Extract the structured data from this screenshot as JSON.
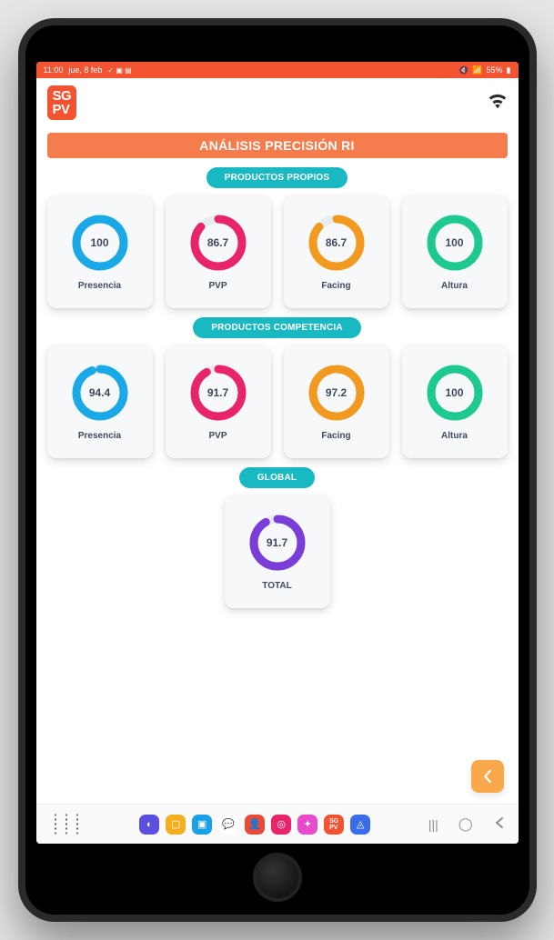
{
  "status": {
    "time": "11:00",
    "date": "jue, 8 feb",
    "battery": "55%"
  },
  "app": {
    "logo_line1": "SG",
    "logo_line2": "PV"
  },
  "title": "ANÁLISIS PRECISIÓN RI",
  "sections": [
    {
      "label": "PRODUCTOS PROPIOS",
      "cards": [
        {
          "value": "100",
          "pct": 100,
          "label": "Presencia",
          "color": "#18a9e6"
        },
        {
          "value": "86.7",
          "pct": 86.7,
          "label": "PVP",
          "color": "#e8256b"
        },
        {
          "value": "86.7",
          "pct": 86.7,
          "label": "Facing",
          "color": "#f29a1f"
        },
        {
          "value": "100",
          "pct": 100,
          "label": "Altura",
          "color": "#1ec98f"
        }
      ]
    },
    {
      "label": "PRODUCTOS COMPETENCIA",
      "cards": [
        {
          "value": "94.4",
          "pct": 94.4,
          "label": "Presencia",
          "color": "#18a9e6"
        },
        {
          "value": "91.7",
          "pct": 91.7,
          "label": "PVP",
          "color": "#e8256b"
        },
        {
          "value": "97.2",
          "pct": 97.2,
          "label": "Facing",
          "color": "#f29a1f"
        },
        {
          "value": "100",
          "pct": 100,
          "label": "Altura",
          "color": "#1ec98f"
        }
      ]
    },
    {
      "label": "GLOBAL",
      "cards": [
        {
          "value": "91.7",
          "pct": 91.7,
          "label": "TOTAL",
          "color": "#7a3dd8"
        }
      ]
    }
  ],
  "chart_data": [
    {
      "type": "pie",
      "title": "Productos Propios",
      "series": [
        {
          "name": "Presencia",
          "values": [
            100
          ]
        },
        {
          "name": "PVP",
          "values": [
            86.7
          ]
        },
        {
          "name": "Facing",
          "values": [
            86.7
          ]
        },
        {
          "name": "Altura",
          "values": [
            100
          ]
        }
      ],
      "ylim": [
        0,
        100
      ]
    },
    {
      "type": "pie",
      "title": "Productos Competencia",
      "series": [
        {
          "name": "Presencia",
          "values": [
            94.4
          ]
        },
        {
          "name": "PVP",
          "values": [
            91.7
          ]
        },
        {
          "name": "Facing",
          "values": [
            97.2
          ]
        },
        {
          "name": "Altura",
          "values": [
            100
          ]
        }
      ],
      "ylim": [
        0,
        100
      ]
    },
    {
      "type": "pie",
      "title": "Global",
      "series": [
        {
          "name": "TOTAL",
          "values": [
            91.7
          ]
        }
      ],
      "ylim": [
        0,
        100
      ]
    }
  ],
  "navApps": [
    {
      "bg": "#5a4fde",
      "glyph": "◐"
    },
    {
      "bg": "#f2b01f",
      "glyph": "▢"
    },
    {
      "bg": "#1aa0e8",
      "glyph": "▣"
    },
    {
      "bg": "#ffffff",
      "glyph": "💬",
      "fg": "#2a72e8"
    },
    {
      "bg": "#e84a3a",
      "glyph": "👤"
    },
    {
      "bg": "#e8256b",
      "glyph": "◎"
    },
    {
      "bg": "#e74acb",
      "glyph": "✦"
    },
    {
      "bg": "#f35330",
      "glyph": "SG"
    },
    {
      "bg": "#3a6be8",
      "glyph": "◬"
    }
  ]
}
